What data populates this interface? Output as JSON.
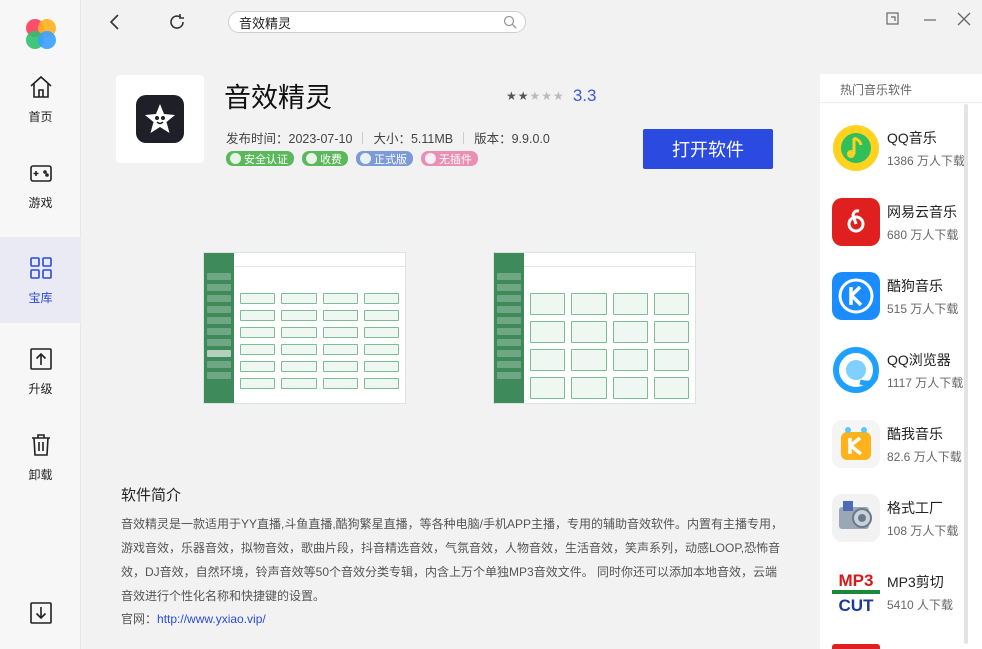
{
  "nav": {
    "items": [
      {
        "label": "首页",
        "icon": "home-icon"
      },
      {
        "label": "游戏",
        "icon": "gamepad-icon"
      },
      {
        "label": "宝库",
        "icon": "grid-icon"
      },
      {
        "label": "升级",
        "icon": "upgrade-icon"
      },
      {
        "label": "卸载",
        "icon": "trash-icon"
      }
    ],
    "bottom_icon": "download-icon",
    "active": "宝库",
    "accent": "#2b4ad8"
  },
  "search": {
    "value": "音效精灵"
  },
  "app": {
    "name": "音效精灵",
    "rating": 3.3,
    "rating_text": "3.3",
    "meta": {
      "release": "发布时间：2023-07-10",
      "size": "大小：5.11MB",
      "version": "版本：9.9.0.0"
    },
    "badges": [
      {
        "label": "安全认证",
        "color": "#5cb85c"
      },
      {
        "label": "收费",
        "color": "#5cb85c"
      },
      {
        "label": "正式版",
        "color": "#7b9ad8"
      },
      {
        "label": "无插件",
        "color": "#e98fb3"
      }
    ],
    "open_label": "打开软件"
  },
  "intro": {
    "title": "软件简介",
    "body": "音效精灵是一款适用于YY直播,斗鱼直播,酷狗繁星直播，等各种电脑/手机APP主播，专用的辅助音效软件。内置有主播专用，游戏音效，乐器音效，拟物音效，歌曲片段，抖音精选音效，气氛音效，人物音效，生活音效，笑声系列，动感LOOP,恐怖音效，DJ音效，自然环境，铃声音效等50个音效分类专辑，内含上万个单独MP3音效文件。 同时你还可以添加本地音效，云端音效进行个性化名称和快捷键的设置。",
    "site_label": "官网：",
    "site_url": "http://www.yxiao.vip/"
  },
  "hot": {
    "title": "热门音乐软件",
    "items": [
      {
        "name": "QQ音乐",
        "count": "1386 万人下载"
      },
      {
        "name": "网易云音乐",
        "count": "680 万人下载"
      },
      {
        "name": "酷狗音乐",
        "count": "515 万人下载"
      },
      {
        "name": "QQ浏览器",
        "count": "1117 万人下载"
      },
      {
        "name": "酷我音乐",
        "count": "82.6 万人下载"
      },
      {
        "name": "格式工厂",
        "count": "108 万人下载"
      },
      {
        "name": "MP3剪切",
        "count": "5410 人下载"
      }
    ]
  }
}
